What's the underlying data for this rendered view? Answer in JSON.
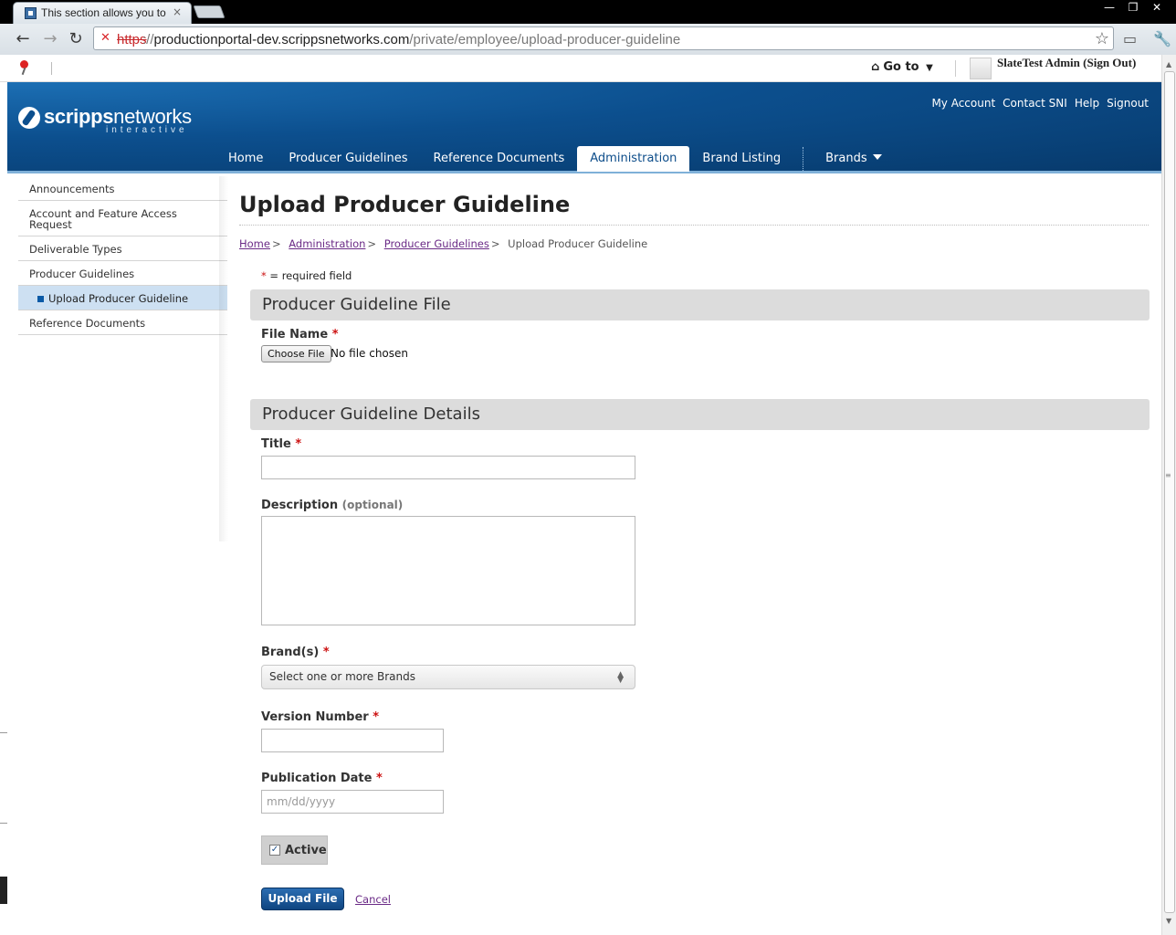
{
  "browser": {
    "tab_title": "This section allows you to",
    "tab_close": "×",
    "window_controls": [
      "—",
      "❐",
      "✕"
    ],
    "url_scheme": "https",
    "url_scheme_sep": "://",
    "url_host": "productionportal-dev.scrippsnetworks.com",
    "url_path": "/private/employee/upload-producer-guideline",
    "nav_back": "←",
    "nav_forward": "→",
    "nav_reload": "↻"
  },
  "bookmarks_bar": {
    "goto_label": "Go to",
    "user_text": "SlateTest Admin (Sign Out)"
  },
  "header": {
    "logo_bold": "scripps",
    "logo_regular": "networks",
    "logo_sub": "interactive",
    "util_links": [
      "My Account",
      "Contact SNI",
      "Help",
      "Signout"
    ],
    "nav": [
      "Home",
      "Producer Guidelines",
      "Reference Documents",
      "Administration",
      "Brand Listing"
    ],
    "brands_label": "Brands"
  },
  "sidebar": {
    "items": [
      {
        "label": "Announcements"
      },
      {
        "label": "Account and Feature Access Request"
      },
      {
        "label": "Deliverable Types"
      },
      {
        "label": "Producer Guidelines"
      },
      {
        "label": "Upload Producer Guideline"
      },
      {
        "label": "Reference Documents"
      }
    ]
  },
  "main": {
    "title": "Upload Producer Guideline",
    "breadcrumb": [
      "Home",
      "Administration",
      "Producer Guidelines",
      "Upload Producer Guideline"
    ],
    "required_marker": "*",
    "required_note": "= required field",
    "section_file": "Producer Guideline File",
    "file_label": "File Name",
    "file_button": "Choose File",
    "file_status": "No file chosen",
    "section_details": "Producer Guideline Details",
    "title_label": "Title",
    "description_label": "Description",
    "description_optional": "(optional)",
    "brands_label": "Brand(s)",
    "brands_placeholder": "Select one or more Brands",
    "version_label": "Version Number",
    "date_label": "Publication Date",
    "date_placeholder": "mm/dd/yyyy",
    "active_label": "Active",
    "active_checked": true,
    "upload_button": "Upload File",
    "cancel_link": "Cancel"
  },
  "colors": {
    "header_blue": "#0c4f8e",
    "link_purple": "#6a2a86",
    "required_red": "#cc1111",
    "sidebar_selected": "#cde0f2"
  }
}
